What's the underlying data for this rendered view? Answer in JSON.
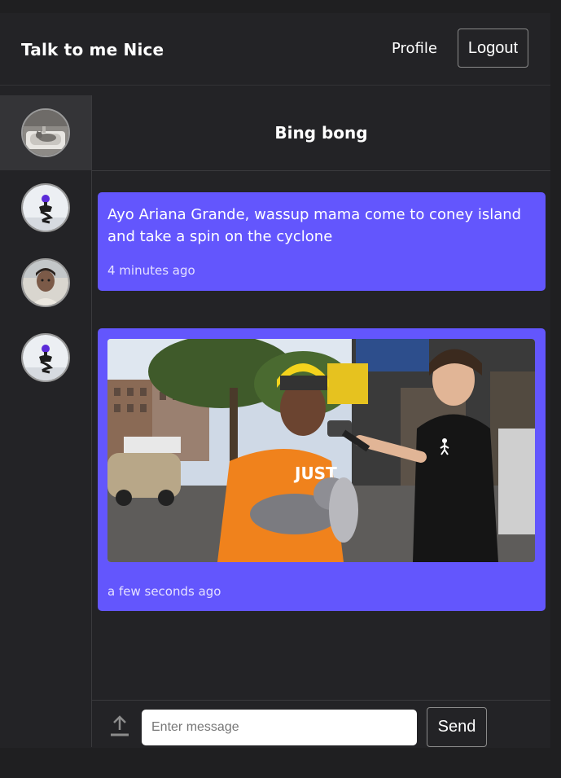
{
  "header": {
    "brand": "Talk to me Nice",
    "profile_label": "Profile",
    "logout_label": "Logout"
  },
  "sidebar": {
    "contacts": [
      {
        "avatar": "cat-in-sink-photo",
        "active": true
      },
      {
        "avatar": "cartoon-figure-photo",
        "active": false
      },
      {
        "avatar": "person-portrait-photo",
        "active": false
      },
      {
        "avatar": "cartoon-figure-photo",
        "active": false
      }
    ]
  },
  "chat": {
    "title": "Bing bong",
    "messages": [
      {
        "type": "text",
        "text": "Ayo Ariana Grande, wassup mama come to coney island and take a spin on the cyclone",
        "time": "4 minutes ago"
      },
      {
        "type": "image",
        "image": "street-interview-photo",
        "time": "a few seconds ago"
      }
    ]
  },
  "composer": {
    "placeholder": "Enter message",
    "value": "",
    "send_label": "Send",
    "upload_icon": "upload-icon"
  },
  "colors": {
    "page_bg": "#1f1f21",
    "app_bg": "#232326",
    "message_bubble": "#6356fd",
    "border": "#3a3a3d"
  }
}
